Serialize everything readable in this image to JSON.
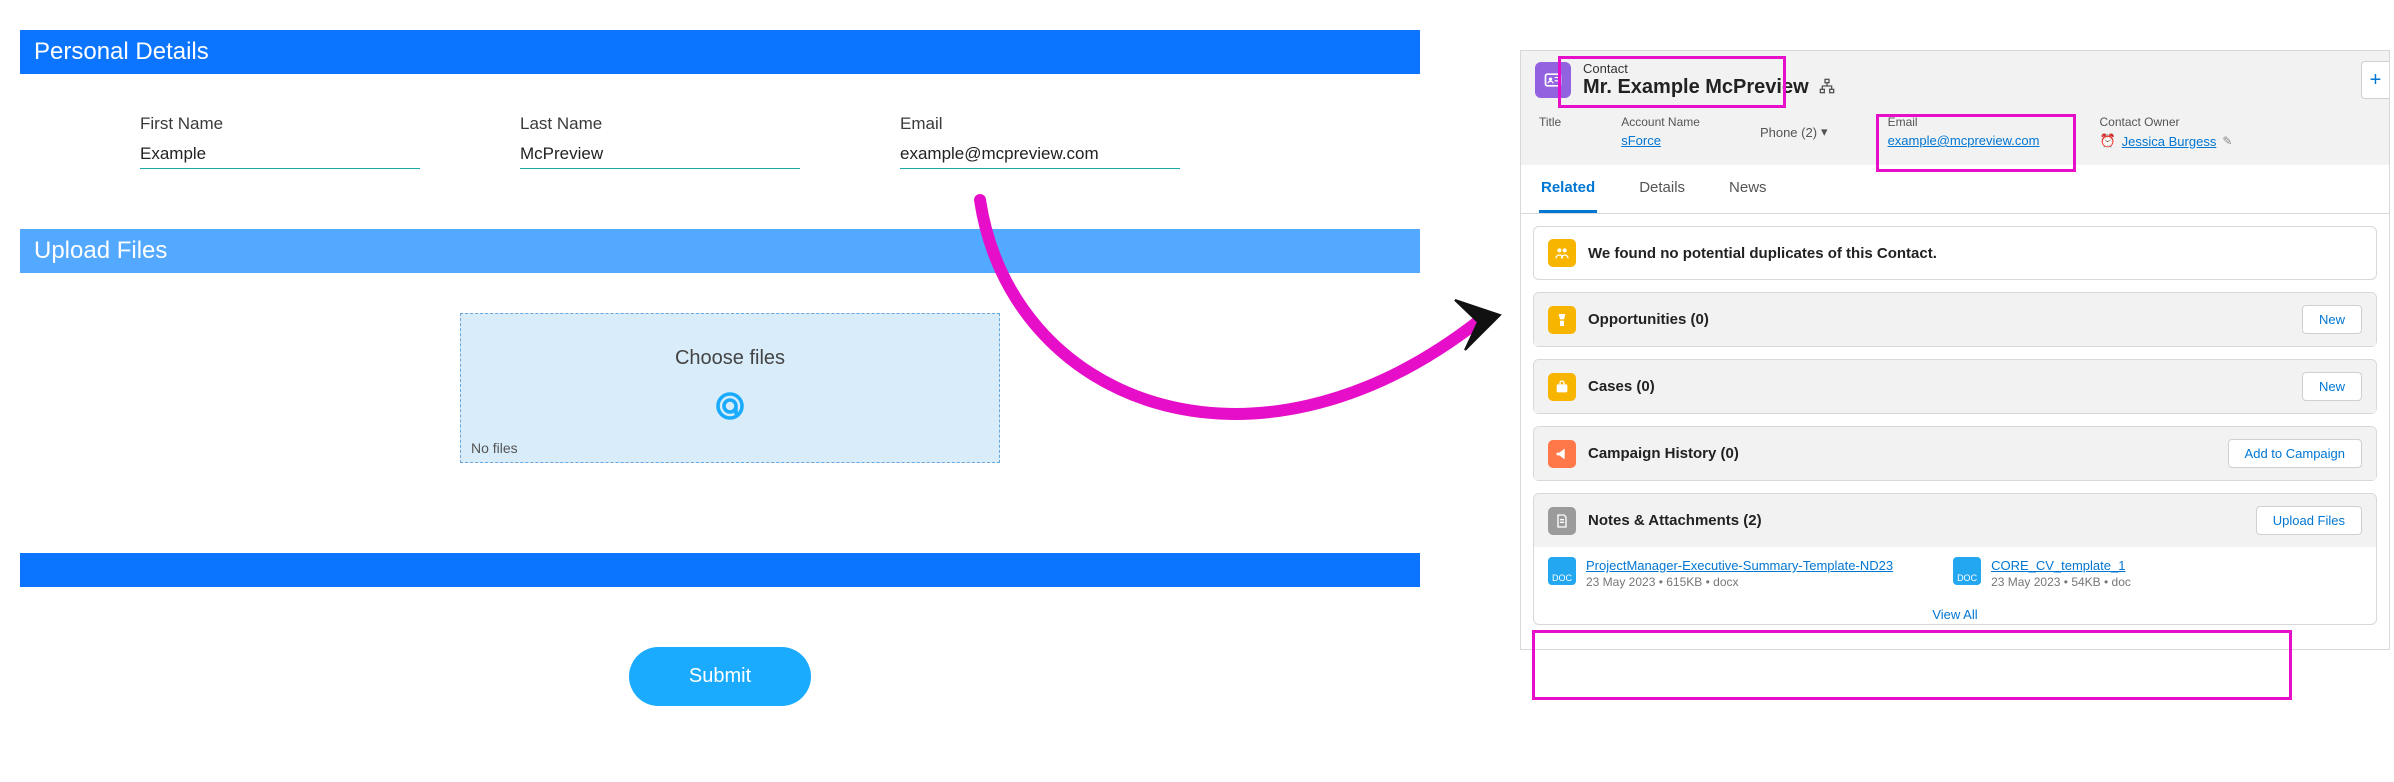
{
  "form": {
    "section_personal": "Personal Details",
    "first_name_label": "First Name",
    "first_name_value": "Example",
    "last_name_label": "Last Name",
    "last_name_value": "McPreview",
    "email_label": "Email",
    "email_value": "example@mcpreview.com",
    "section_upload": "Upload Files",
    "choose_files": "Choose files",
    "no_files": "No files",
    "submit": "Submit"
  },
  "sf": {
    "contact_label": "Contact",
    "contact_name": "Mr. Example McPreview",
    "fields": {
      "title_label": "Title",
      "account_label": "Account Name",
      "account_value": "sForce",
      "phone_label": "Phone (2)",
      "email_label": "Email",
      "email_value": "example@mcpreview.com",
      "owner_label": "Contact Owner",
      "owner_value": "Jessica Burgess"
    },
    "tabs": {
      "related": "Related",
      "details": "Details",
      "news": "News"
    },
    "dup_msg": "We found no potential duplicates of this Contact.",
    "opportunities": "Opportunities (0)",
    "new_btn": "New",
    "cases": "Cases (0)",
    "campaign": "Campaign History (0)",
    "add_campaign": "Add to Campaign",
    "notes": "Notes & Attachments (2)",
    "upload_files": "Upload Files",
    "att1": {
      "name": "ProjectManager-Executive-Summary-Template-ND23",
      "meta": "23 May 2023 • 615KB • docx",
      "ext": "DOC"
    },
    "att2": {
      "name": "CORE_CV_template_1",
      "meta": "23 May 2023 • 54KB • doc",
      "ext": "DOC"
    },
    "view_all": "View All"
  }
}
